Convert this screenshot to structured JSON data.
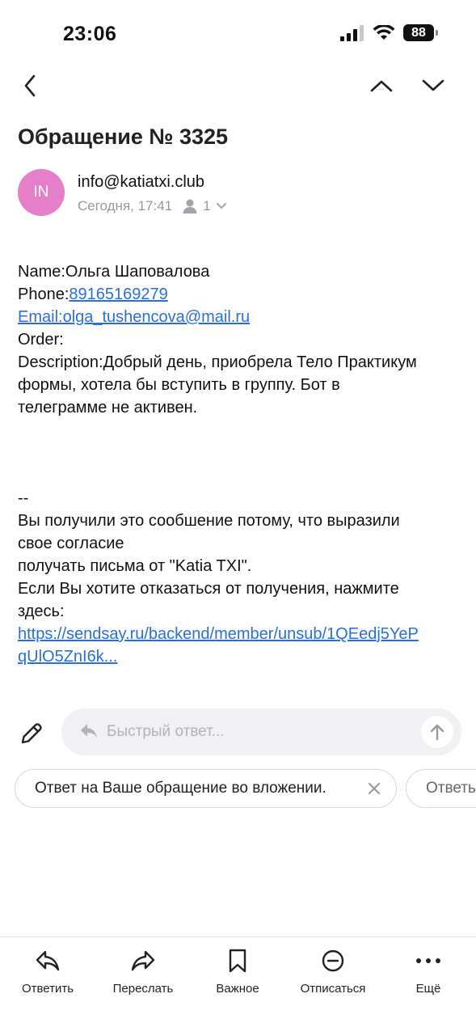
{
  "status": {
    "time": "23:06",
    "battery": "88"
  },
  "nav": {
    "back_icon": "chevron-left-icon",
    "prev_icon": "chevron-up-icon",
    "next_icon": "chevron-down-icon"
  },
  "message": {
    "subject": "Обращение № 3325",
    "avatar_initials": "IN",
    "avatar_color": "#e57fc9",
    "sender": "info@katiatxi.club",
    "date": "Сегодня, 17:41",
    "recipients_count": "1",
    "body": {
      "name_label": "Name:",
      "name_value": "Ольга Шаповалова",
      "phone_label": "Phone:",
      "phone_value": "89165169279",
      "email_link": "Email:olga_tushencova@mail.ru",
      "order_label": "Order:",
      "desc_line1": "Description:Добрый день, приобрела Тело Практикум",
      "desc_line2": "формы, хотела бы вступить в группу. Бот в",
      "desc_line3": "телеграмме не активен.",
      "sig_sep": "--",
      "footer_line1": "Вы получили это сообшение потому, что выразили",
      "footer_line2": "свое согласие",
      "footer_line3": "получать письма от \"Katia TXI\".",
      "footer_line4": "Если Вы хотите отказаться от получения, нажмите",
      "footer_line5": "здесь:",
      "unsub_link_line1": "https://sendsay.ru/backend/member/unsub/1QEedj5YeP",
      "unsub_link_line2": "qUlO5ZnI6k..."
    }
  },
  "compose": {
    "placeholder": "Быстрый ответ..."
  },
  "suggestions": [
    {
      "label": "Ответ на Ваше обращение во вложении."
    },
    {
      "label": "Ответь"
    }
  ],
  "toolbar": [
    {
      "label": "Ответить",
      "icon": "reply-icon"
    },
    {
      "label": "Переслать",
      "icon": "forward-icon"
    },
    {
      "label": "Важное",
      "icon": "bookmark-icon"
    },
    {
      "label": "Отписаться",
      "icon": "unsubscribe-icon"
    },
    {
      "label": "Ещё",
      "icon": "more-icon"
    }
  ],
  "colors": {
    "link": "#2b6fd8",
    "muted": "#999999",
    "accent_avatar": "#e57fc9"
  }
}
